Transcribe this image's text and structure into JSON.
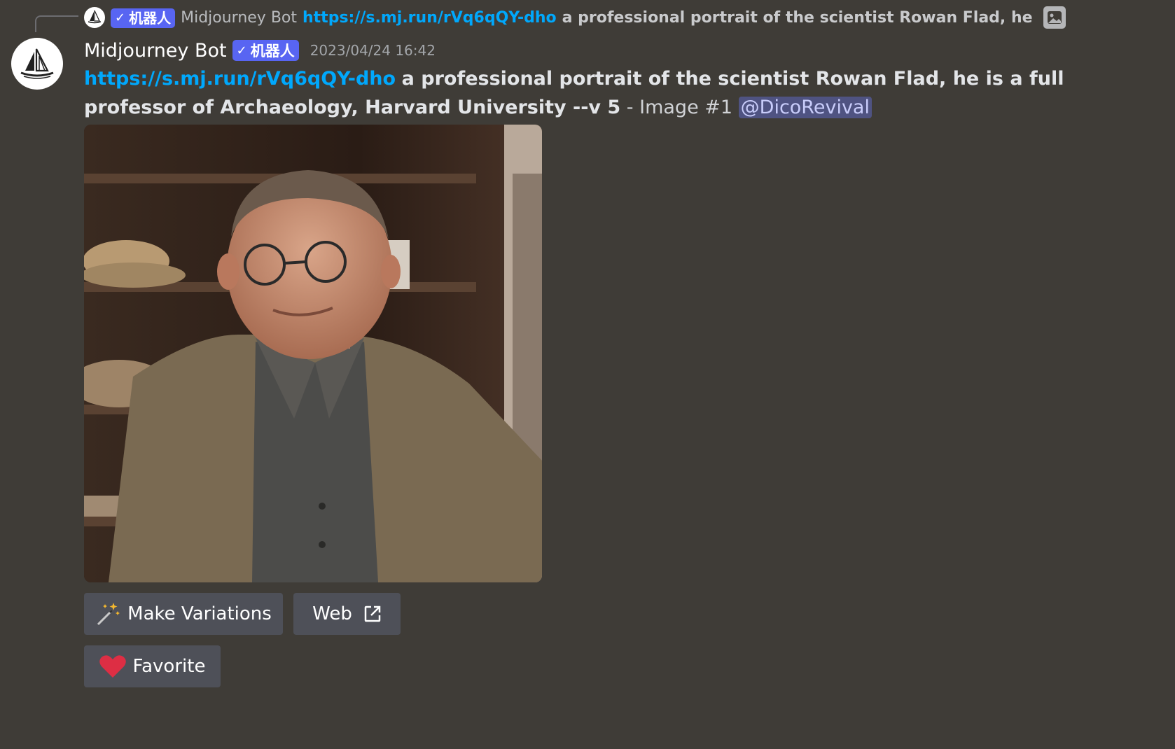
{
  "reply": {
    "bot_tag_check": "✓",
    "bot_tag": "机器人",
    "author": "Midjourney Bot",
    "link": "https://s.mj.run/rVq6qQY-dho",
    "text": "a professional portrait of the scientist Rowan Flad, he is a f"
  },
  "header": {
    "username": "Midjourney Bot",
    "bot_tag_check": "✓",
    "bot_tag": "机器人",
    "timestamp": "2023/04/24 16:42"
  },
  "message": {
    "link": "https://s.mj.run/rVq6qQY-dho",
    "prompt": "a professional portrait of the scientist Rowan Flad, he is a full professor of Archaeology, Harvard University --v 5",
    "separator": " - Image #1 ",
    "mention": "@DicoRevival"
  },
  "buttons": {
    "variations": "Make Variations",
    "web": "Web",
    "favorite": "Favorite"
  },
  "icons": {
    "reply_avatar": "midjourney-sailboat-icon",
    "image_attachment": "image-icon",
    "variations": "magic-wand-icon",
    "web": "external-link-icon",
    "favorite": "red-heart-icon"
  },
  "colors": {
    "background": "#3f3c37",
    "link": "#00a8fc",
    "bot_tag": "#5865f2",
    "mention_bg": "#4f5382",
    "button_bg": "#4e5058"
  }
}
